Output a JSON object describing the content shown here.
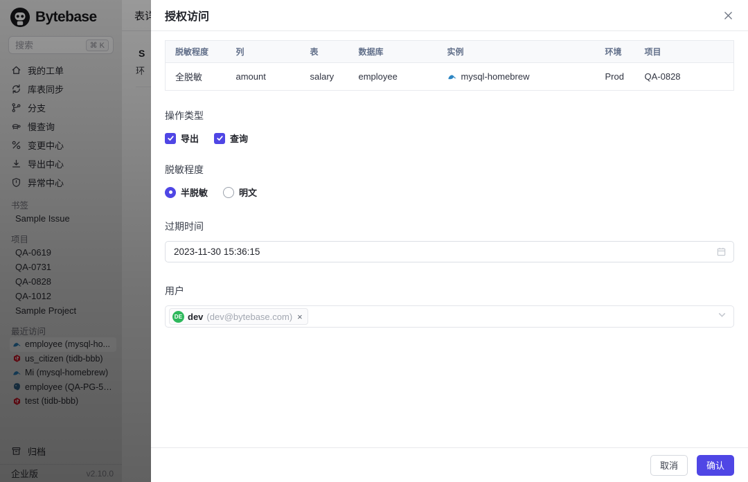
{
  "app": {
    "brand": "Bytebase",
    "edition": "企业版",
    "version": "v2.10.0"
  },
  "colors": {
    "accent": "#4f46e5",
    "avatar_green": "#2eb85c",
    "mysql_blue": "#2d86c3",
    "tidb_red": "#dc1428",
    "postgres_blue": "#336791",
    "sidebar_bg": "#ececec",
    "scrim": "rgba(0,0,0,0.55)"
  },
  "sidebar": {
    "search": {
      "placeholder": "搜索",
      "shortcut": "⌘ K"
    },
    "menu": [
      {
        "icon": "home-icon",
        "label": "我的工单"
      },
      {
        "icon": "sync-icon",
        "label": "库表同步"
      },
      {
        "icon": "branch-icon",
        "label": "分支"
      },
      {
        "icon": "turtle-icon",
        "label": "慢查询"
      },
      {
        "icon": "change-center-icon",
        "label": "变更中心"
      },
      {
        "icon": "download-icon",
        "label": "导出中心"
      },
      {
        "icon": "shield-icon",
        "label": "异常中心"
      }
    ],
    "bookmarks": {
      "label": "书签",
      "items": [
        {
          "label": "Sample Issue"
        }
      ]
    },
    "projects": {
      "label": "项目",
      "items": [
        {
          "label": "QA-0619"
        },
        {
          "label": "QA-0731"
        },
        {
          "label": "QA-0828"
        },
        {
          "label": "QA-1012"
        },
        {
          "label": "Sample Project"
        }
      ]
    },
    "recent": {
      "label": "最近访问",
      "items": [
        {
          "engine": "mysql",
          "label": "employee (mysql-ho...",
          "selected": true
        },
        {
          "engine": "tidb",
          "label": "us_citizen (tidb-bbb)",
          "selected": false
        },
        {
          "engine": "mysql",
          "label": "Mi (mysql-homebrew)",
          "selected": false
        },
        {
          "engine": "postgres",
          "label": "employee (QA-PG-54...",
          "selected": false
        },
        {
          "engine": "tidb",
          "label": "test (tidb-bbb)",
          "selected": false
        }
      ]
    },
    "archive": {
      "label": "归档"
    }
  },
  "background_page": {
    "topbar_title": "表详",
    "heading": "S",
    "subheading": "环"
  },
  "modal": {
    "title": "授权访问",
    "table": {
      "headers": [
        "脱敏程度",
        "列",
        "表",
        "数据库",
        "实例",
        "环境",
        "项目"
      ],
      "row": {
        "masking_level": "全脱敏",
        "column": "amount",
        "table": "salary",
        "database": "employee",
        "instance": "mysql-homebrew",
        "environment": "Prod",
        "project": "QA-0828"
      }
    },
    "operation": {
      "label": "操作类型",
      "options": [
        {
          "label": "导出",
          "checked": true
        },
        {
          "label": "查询",
          "checked": true
        }
      ]
    },
    "masking": {
      "label": "脱敏程度",
      "options": [
        {
          "label": "半脱敏",
          "selected": true
        },
        {
          "label": "明文",
          "selected": false
        }
      ]
    },
    "expire": {
      "label": "过期时间",
      "value": "2023-11-30 15:36:15"
    },
    "user": {
      "label": "用户",
      "tag": {
        "initials": "DE",
        "name": "dev",
        "email": "(dev@bytebase.com)",
        "remove": "×"
      }
    },
    "footer": {
      "cancel": "取消",
      "confirm": "确认"
    }
  }
}
